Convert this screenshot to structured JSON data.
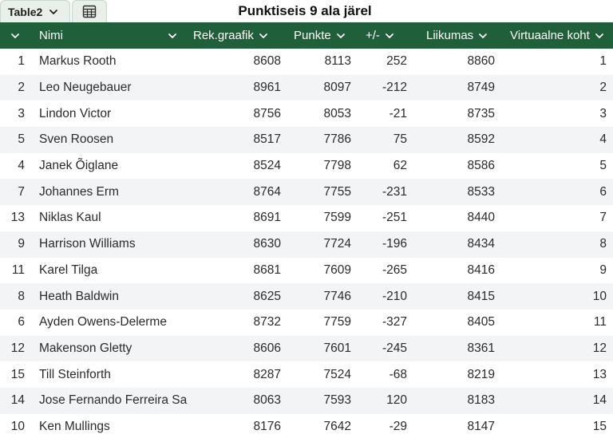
{
  "tab": {
    "name": "Table2",
    "view_icon": "table-view-icon"
  },
  "title": "Punktiseis 9 ala järel",
  "columns": [
    {
      "label": "",
      "icon": "chevron-down-icon"
    },
    {
      "label": "Nimi"
    },
    {
      "label": "Rek.graafik"
    },
    {
      "label": "Punkte"
    },
    {
      "label": "+/-"
    },
    {
      "label": "Liikumas"
    },
    {
      "label": "Virtuaalne koht"
    }
  ],
  "rows": [
    [
      "1",
      "Markus Rooth",
      "8608",
      "8113",
      "252",
      "8860",
      "1"
    ],
    [
      "2",
      "Leo Neugebauer",
      "8961",
      "8097",
      "-212",
      "8749",
      "2"
    ],
    [
      "3",
      "Lindon Victor",
      "8756",
      "8053",
      "-21",
      "8735",
      "3"
    ],
    [
      "5",
      "Sven Roosen",
      "8517",
      "7786",
      "75",
      "8592",
      "4"
    ],
    [
      "4",
      "Janek Õiglane",
      "8524",
      "7798",
      "62",
      "8586",
      "5"
    ],
    [
      "7",
      "Johannes Erm",
      "8764",
      "7755",
      "-231",
      "8533",
      "6"
    ],
    [
      "13",
      "Niklas Kaul",
      "8691",
      "7599",
      "-251",
      "8440",
      "7"
    ],
    [
      "9",
      "Harrison Williams",
      "8630",
      "7724",
      "-196",
      "8434",
      "8"
    ],
    [
      "11",
      "Karel Tilga",
      "8681",
      "7609",
      "-265",
      "8416",
      "9"
    ],
    [
      "8",
      "Heath Baldwin",
      "8625",
      "7746",
      "-210",
      "8415",
      "10"
    ],
    [
      "6",
      "Ayden Owens-Delerme",
      "8732",
      "7759",
      "-327",
      "8405",
      "11"
    ],
    [
      "12",
      "Makenson Gletty",
      "8606",
      "7601",
      "-245",
      "8361",
      "12"
    ],
    [
      "15",
      "Till Steinforth",
      "8287",
      "7524",
      "-68",
      "8219",
      "13"
    ],
    [
      "14",
      "Jose Fernando Ferreira Sa",
      "8063",
      "7593",
      "120",
      "8183",
      "14"
    ],
    [
      "10",
      "Ken Mullings",
      "8176",
      "7642",
      "-29",
      "8147",
      "15"
    ]
  ],
  "colors": {
    "header_bg": "#1f5f3a",
    "stripe": "#f3f4f5",
    "tab_bg": "#e8f0e9"
  }
}
